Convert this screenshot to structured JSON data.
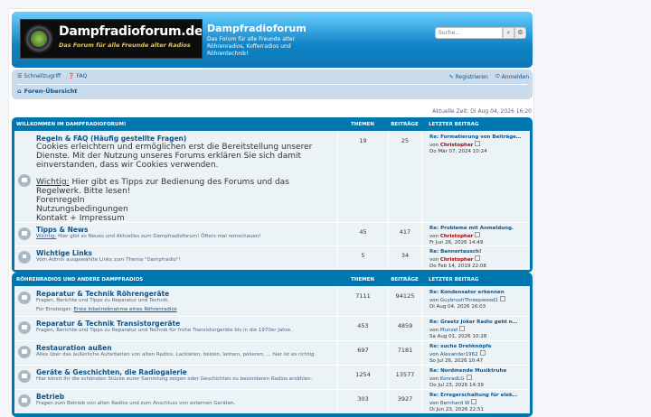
{
  "header": {
    "logo_title": "Dampfradioforum.de",
    "logo_subtitle": "Das Forum für alle Freunde alter Radios",
    "site_title": "Dampfradioforum",
    "site_description": "Das Forum für alle Freunde alter Röhrenradios, Kofferradios und Röhrentechnik!",
    "search_placeholder": "Suche…"
  },
  "navbar": {
    "quick_access": "Schnellzugriff",
    "faq": "FAQ",
    "register": "Registrieren",
    "login": "Anmelden",
    "breadcrumb": "Foren-Übersicht"
  },
  "current_time": "Aktuelle Zeit: Di Aug 04, 2026 16:20",
  "columns": {
    "topics": "THEMEN",
    "posts": "BEITRÄGE",
    "last_post": "LETZTER BEITRAG"
  },
  "categories": [
    {
      "name": "WILLKOMMEN IM DAMPFRADIOFORUM!",
      "forums": [
        {
          "title": "Regeln & FAQ (Häufig gestellte Fragen)",
          "cookie_text": "Cookies erleichtern und ermöglichen erst die Bereitstellung unserer Dienste. Mit der Nutzung unseres Forums erklären Sie sich damit einverstanden, dass wir Cookies verwenden.",
          "important_label": "Wichtig:",
          "important_text": " Hier gibt es Tipps zur Bedienung des Forums und das Regelwerk. Bitte lesen!",
          "link1": "Forenregeln",
          "link2": "Nutzungsbedingungen",
          "link3": "Kontakt + Impressum",
          "topics": "19",
          "posts": "25",
          "last_title": "Re: Formatierung von Beiträge…",
          "last_by": "von",
          "last_author": "Christopher",
          "last_date": "Do Mär 07, 2024 10:24"
        },
        {
          "title": "Tipps & News",
          "desc_label": "Wichtig:",
          "desc": " Hier gibt es Neues und Aktuelles zum Dampfradioforum! Öfters mal reinschauen!",
          "topics": "45",
          "posts": "417",
          "last_title": "Re: Probleme mit Anmeldung.",
          "last_by": "von",
          "last_author": "Christopher",
          "last_date": "Fr Jun 26, 2026 14:49"
        },
        {
          "title": "Wichtige Links",
          "desc": "Vom Admin ausgewählte Links zum Thema \"Dampfradio\"!",
          "topics": "5",
          "posts": "34",
          "last_title": "Re: Bannertausch!",
          "last_by": "von",
          "last_author": "Christopher",
          "last_date": "Do Feb 14, 2019 22:08"
        }
      ]
    },
    {
      "name": "RÖHRENRADIOS UND ANDERE DAMPFRADIOS",
      "forums": [
        {
          "title": "Reparatur & Technik Röhrengeräte",
          "desc": "Fragen, Berichte und Tipps zu Reparatur und Technik.",
          "sub_label": "Für Einsteiger:",
          "sub_link": "Erste Inbetriebnahme eines Röhrenradios",
          "topics": "7111",
          "posts": "94125",
          "last_title": "Re: Kondensator erkennen",
          "last_by": "von",
          "last_author": "GuybrushThreepwood1",
          "last_date": "Di Aug 04, 2026 16:03"
        },
        {
          "title": "Reparatur & Technik Transistorgeräte",
          "desc": "Fragen, Berichte und Tipps zu Reparatur und Technik für frühe Transistorgeräte bis in die 1970er Jahre.",
          "topics": "453",
          "posts": "4859",
          "last_title": "Re: Graetz Joker Radio geht n…",
          "last_by": "von",
          "last_author": "Munzel",
          "last_date": "Sa Aug 01, 2026 10:28"
        },
        {
          "title": "Restauration außen",
          "desc": "Alles über das äußerliche Aufarbeiten von alten Radios. Lackieren, beizen, leimen, polieren, ... hier ist es richtig.",
          "topics": "697",
          "posts": "7181",
          "last_title": "Re: suche Drehknöpfe",
          "last_by": "von",
          "last_author": "Alexander1962",
          "last_date": "So Jul 26, 2026 10:47"
        },
        {
          "title": "Geräte & Geschichten, die Radiogalerie",
          "desc": "Hier könnt Ihr die schönsten Stücke eurer Sammlung zeigen oder Geschichten zu besonderen Radios erzählen.",
          "topics": "1254",
          "posts": "13577",
          "last_title": "Re: Nordmende Musiktruhe",
          "last_by": "von",
          "last_author": "KonradLG",
          "last_date": "Do Jul 23, 2026 14:39"
        },
        {
          "title": "Betrieb",
          "desc": "Fragen zum Betrieb von alten Radios und zum Anschluss von externen Geräten.",
          "topics": "303",
          "posts": "3927",
          "last_title": "Re: Erregerschaltung für elek…",
          "last_by": "von",
          "last_author": "Bernhard W",
          "last_date": "Di Jun 23, 2026 22:51"
        }
      ]
    }
  ]
}
